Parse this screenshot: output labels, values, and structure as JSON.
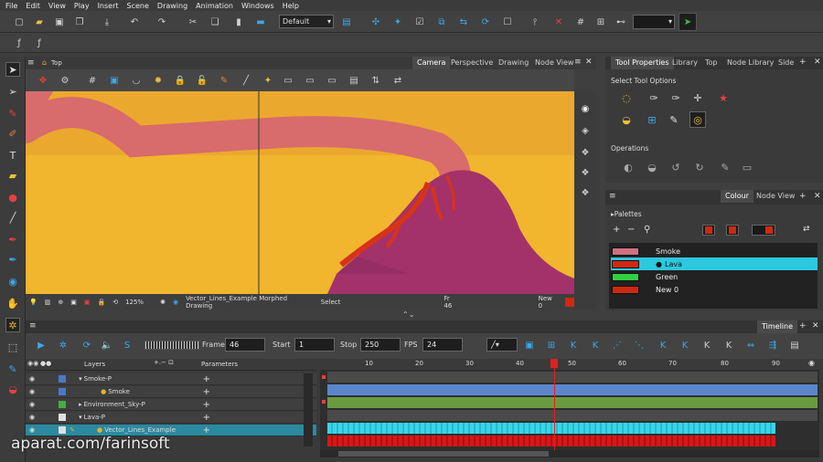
{
  "menu": [
    "File",
    "Edit",
    "View",
    "Play",
    "Insert",
    "Scene",
    "Drawing",
    "Animation",
    "Windows",
    "Help"
  ],
  "toolbar": {
    "workspace": "Default"
  },
  "view": {
    "breadcrumb": "Top",
    "tabs": [
      "Camera",
      "Perspective",
      "Drawing",
      "Node View"
    ],
    "active_tab": "Camera",
    "zoom": "125%",
    "status_drawing": "Vector_Lines_Example Morphed Drawing",
    "status_tool": "Select",
    "status_frame": "Fr 46",
    "status_colour": "New 0"
  },
  "tool_props": {
    "tabs": [
      "Tool Properties",
      "Library",
      "Top",
      "Node Library",
      "Side"
    ],
    "select_options": "Select Tool Options",
    "operations": "Operations"
  },
  "colour_panel": {
    "tabs": [
      "Colour",
      "Node View"
    ],
    "palettes_label": "Palettes",
    "swatches": [
      {
        "name": "Smoke",
        "color": "#d07080"
      },
      {
        "name": "Lava",
        "color": "#d02810"
      },
      {
        "name": "Green",
        "color": "#30d040"
      },
      {
        "name": "New 0",
        "color": "#d02810"
      }
    ],
    "selected": "Lava"
  },
  "timeline": {
    "title": "Timeline",
    "frame_label": "Frame",
    "frame": "46",
    "start_label": "Start",
    "start": "1",
    "stop_label": "Stop",
    "stop": "250",
    "fps_label": "FPS",
    "fps": "24",
    "layers_header": "Layers",
    "params_header": "Parameters",
    "ruler": [
      "10",
      "20",
      "30",
      "40",
      "50",
      "60",
      "70",
      "80",
      "90"
    ],
    "layers": [
      {
        "name": "Smoke-P",
        "color": "#4a78c8"
      },
      {
        "name": "Smoke",
        "color": "#4a78c8"
      },
      {
        "name": "Environment_Sky-P",
        "color": "#40b040"
      },
      {
        "name": "Lava-P",
        "color": "#e0e0e0"
      },
      {
        "name": "Vector_Lines_Example",
        "color": "#e0e0e0"
      }
    ]
  },
  "watermark": "aparat.com/farinsoft"
}
